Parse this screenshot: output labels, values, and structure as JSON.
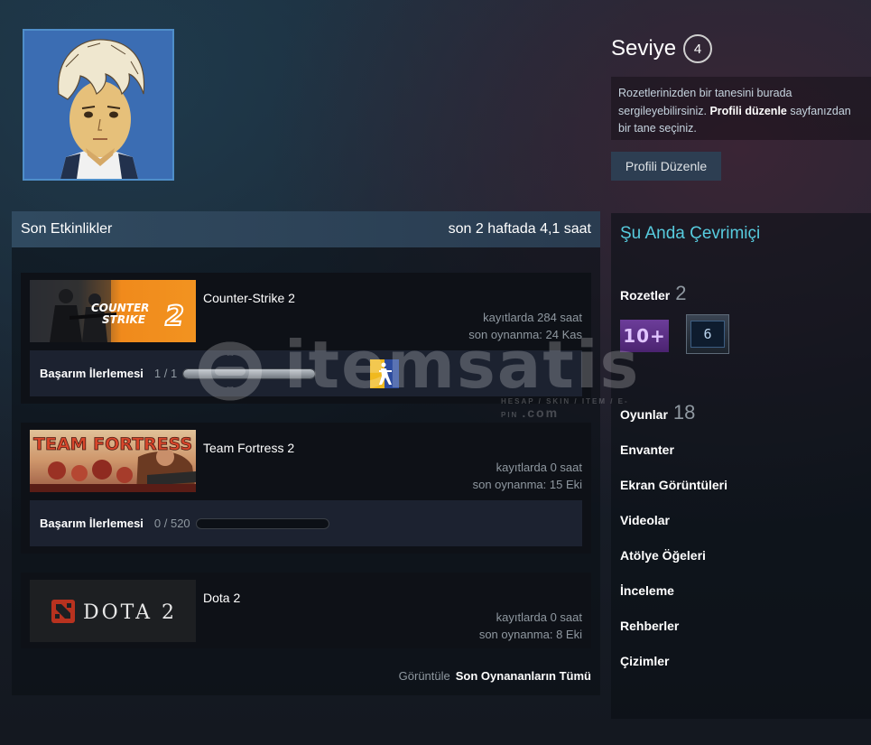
{
  "profile": {
    "level_label": "Seviye",
    "level_value": "4",
    "badge_hint_1": "Rozetlerinizden bir tanesini burada sergileyebilirsiniz. ",
    "badge_hint_link": "Profili düzenle",
    "badge_hint_2": " sayfanızdan bir tane seçiniz.",
    "edit_button": "Profili Düzenle"
  },
  "activity": {
    "title": "Son Etkinlikler",
    "summary": "son 2 haftada 4,1 saat",
    "games": [
      {
        "name": "Counter-Strike 2",
        "capsule_text": "COUNTER STRIKE 2",
        "hours": "kayıtlarda 284 saat",
        "last_played": "son oynanma: 24 Kas",
        "ach_label": "Başarım İlerlemesi",
        "ach_count": "1 / 1",
        "ach_progress": 1.0
      },
      {
        "name": "Team Fortress 2",
        "capsule_text": "TEAM FORTRESS 2",
        "hours": "kayıtlarda 0 saat",
        "last_played": "son oynanma: 15 Eki",
        "ach_label": "Başarım İlerlemesi",
        "ach_count": "0 / 520",
        "ach_progress": 0.0
      },
      {
        "name": "Dota 2",
        "capsule_text": "DOTA 2",
        "hours": "kayıtlarda 0 saat",
        "last_played": "son oynanma: 8 Eki"
      }
    ],
    "view_label": "Görüntüle",
    "view_link": "Son Oynananların Tümü"
  },
  "sidebar": {
    "status": "Şu Anda Çevrimiçi",
    "badges_label": "Rozetler",
    "badges_count": "2",
    "badge1_text": "10+",
    "badge2_text": "6",
    "games_label": "Oyunlar",
    "games_count": "18",
    "links": [
      "Envanter",
      "Ekran Görüntüleri",
      "Videolar",
      "Atölye Öğeleri",
      "İnceleme",
      "Rehberler",
      "Çizimler"
    ]
  },
  "watermark": {
    "text": "itemsatis",
    "sub": "HESAP / SKIN / ITEM / E-PIN",
    "suffix": ".com"
  },
  "colors": {
    "accent_online": "#57cbde",
    "header_blue": "#304a60",
    "cs2_orange": "#f08a1c",
    "dota_red": "#b8321f"
  }
}
